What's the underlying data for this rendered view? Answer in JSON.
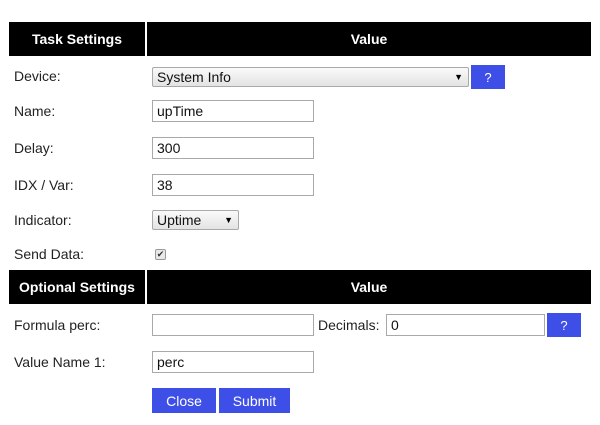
{
  "task_settings": {
    "header_label": "Task Settings",
    "value_header": "Value",
    "device": {
      "label": "Device:",
      "selected": "System Info",
      "help": "?"
    },
    "name": {
      "label": "Name:",
      "value": "upTime"
    },
    "delay": {
      "label": "Delay:",
      "value": "300"
    },
    "idx": {
      "label": "IDX / Var:",
      "value": "38"
    },
    "indicator": {
      "label": "Indicator:",
      "selected": "Uptime"
    },
    "send_data": {
      "label": "Send Data:",
      "checked": true,
      "check_glyph": "✔"
    }
  },
  "optional_settings": {
    "header_label": "Optional Settings",
    "value_header": "Value",
    "formula": {
      "label": "Formula perc:",
      "value": ""
    },
    "decimals": {
      "label": "Decimals:",
      "value": "0",
      "help": "?"
    },
    "value_name": {
      "label": "Value Name 1:",
      "value": "perc"
    }
  },
  "actions": {
    "close_label": "Close",
    "submit_label": "Submit"
  },
  "colors": {
    "header_bg": "#000000",
    "accent": "#3d4fe6"
  }
}
